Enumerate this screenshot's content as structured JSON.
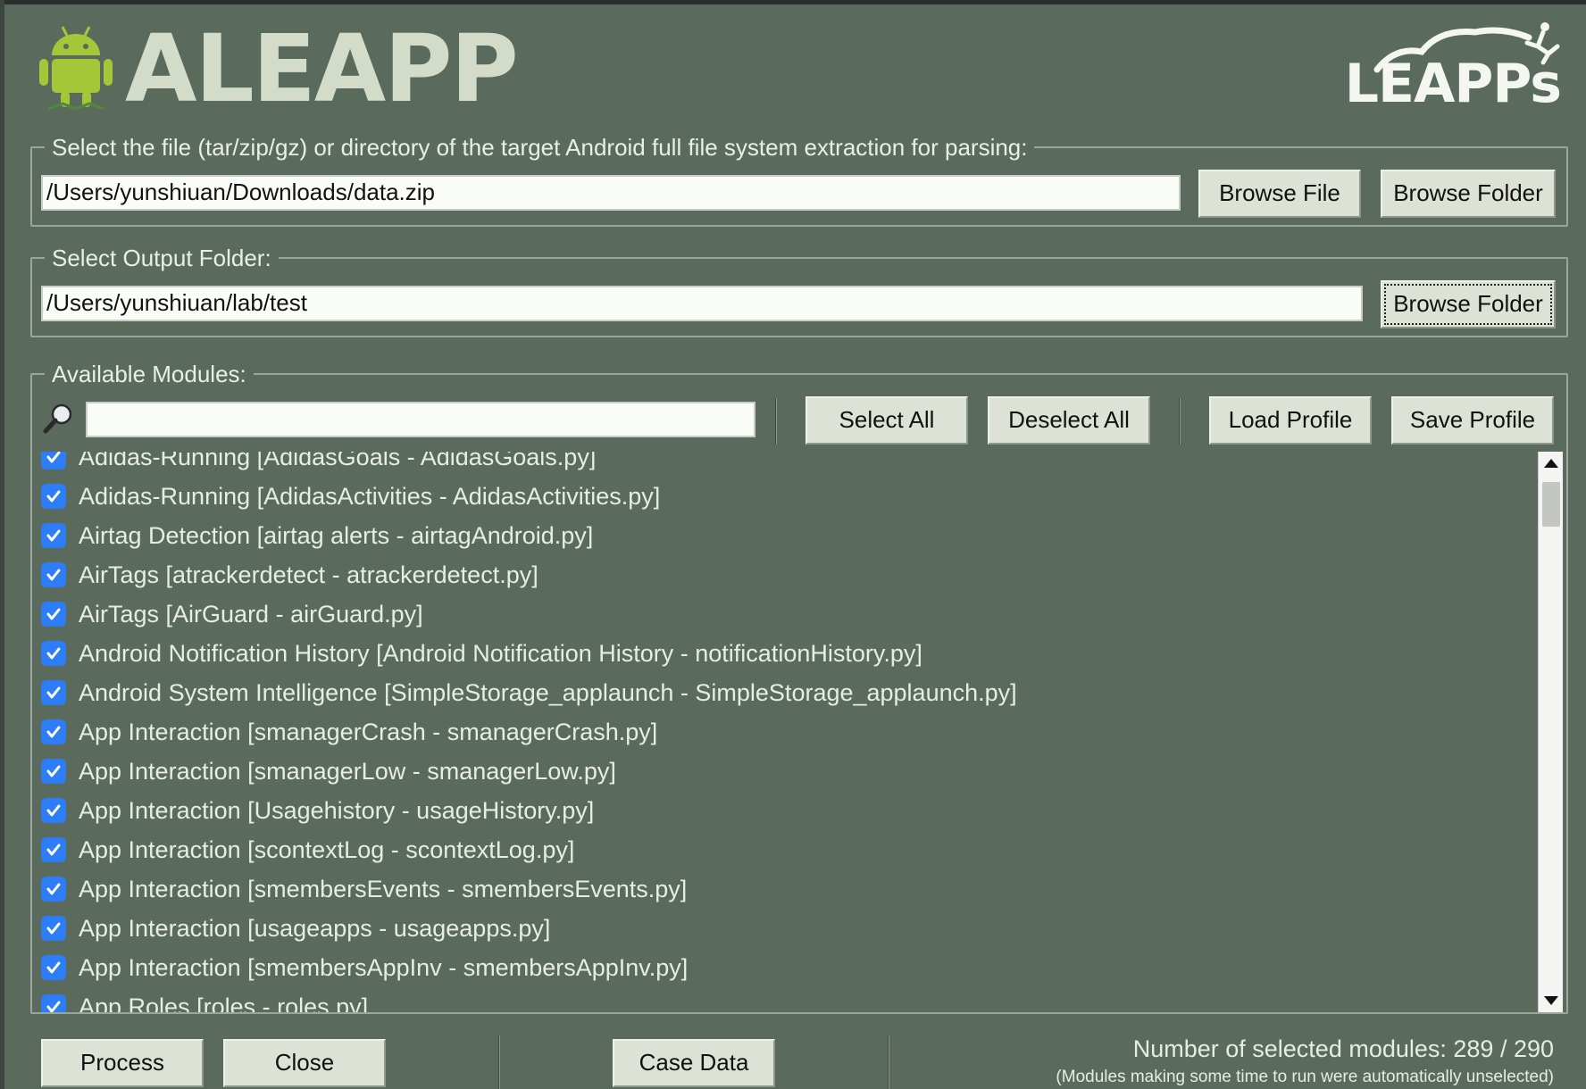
{
  "app": {
    "title": "ALEAPP",
    "brand": "LEAPPs"
  },
  "input_group": {
    "legend": "Select the file (tar/zip/gz) or directory of the target Android full file system extraction for parsing:",
    "path": "/Users/yunshiuan/Downloads/data.zip",
    "browse_file": "Browse File",
    "browse_folder": "Browse Folder"
  },
  "output_group": {
    "legend": "Select Output Folder:",
    "path": "/Users/yunshiuan/lab/test",
    "browse_folder": "Browse Folder"
  },
  "modules_group": {
    "legend": "Available Modules:",
    "search_value": "",
    "select_all": "Select All",
    "deselect_all": "Deselect All",
    "load_profile": "Load Profile",
    "save_profile": "Save Profile",
    "items": [
      {
        "label": "Adidas-Running [AdidasGoals - AdidasGoals.py]",
        "checked": true
      },
      {
        "label": "Adidas-Running [AdidasActivities - AdidasActivities.py]",
        "checked": true
      },
      {
        "label": "Airtag Detection [airtag alerts - airtagAndroid.py]",
        "checked": true
      },
      {
        "label": "AirTags [atrackerdetect - atrackerdetect.py]",
        "checked": true
      },
      {
        "label": "AirTags [AirGuard - airGuard.py]",
        "checked": true
      },
      {
        "label": "Android Notification History [Android Notification History - notificationHistory.py]",
        "checked": true
      },
      {
        "label": "Android System Intelligence [SimpleStorage_applaunch - SimpleStorage_applaunch.py]",
        "checked": true
      },
      {
        "label": "App Interaction [smanagerCrash - smanagerCrash.py]",
        "checked": true
      },
      {
        "label": "App Interaction [smanagerLow - smanagerLow.py]",
        "checked": true
      },
      {
        "label": "App Interaction [Usagehistory - usageHistory.py]",
        "checked": true
      },
      {
        "label": "App Interaction [scontextLog - scontextLog.py]",
        "checked": true
      },
      {
        "label": "App Interaction [smembersEvents - smembersEvents.py]",
        "checked": true
      },
      {
        "label": "App Interaction [usageapps - usageapps.py]",
        "checked": true
      },
      {
        "label": "App Interaction [smembersAppInv - smembersAppInv.py]",
        "checked": true
      },
      {
        "label": "App Roles [roles - roles.py]",
        "checked": true
      }
    ]
  },
  "footer": {
    "process": "Process",
    "close": "Close",
    "case_data": "Case Data",
    "selected_count": "Number of selected modules: 289 / 290",
    "note": "(Modules making some time to run were automatically unselected)"
  },
  "colors": {
    "background": "#5a6b5e",
    "checkbox": "#2d7df6",
    "logo_green": "#a4c639",
    "title_text": "#d3dcc9"
  }
}
